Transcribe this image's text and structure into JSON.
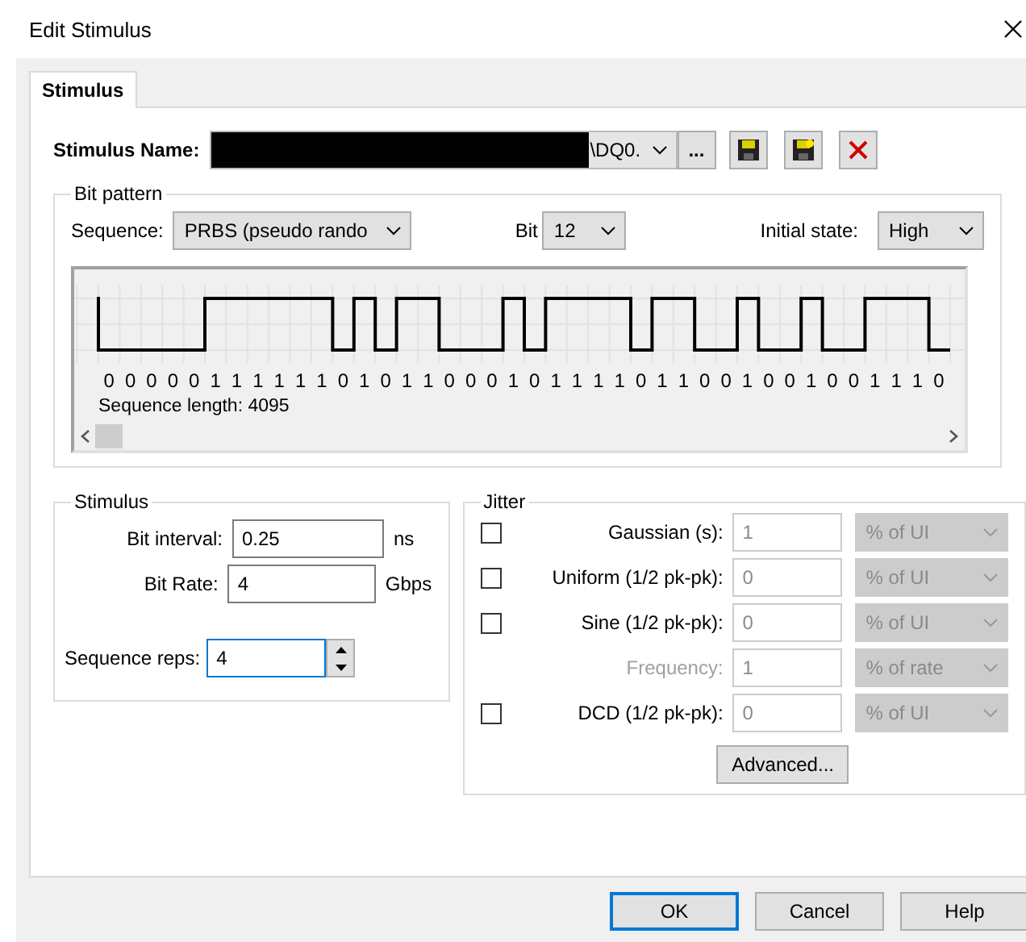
{
  "window": {
    "title": "Edit Stimulus"
  },
  "tabs": [
    {
      "label": "Stimulus",
      "selected": true
    }
  ],
  "stimulus_name": {
    "label": "Stimulus Name:",
    "value": "\\DQ0.",
    "redacted": true,
    "browse": "..."
  },
  "bit_pattern": {
    "title": "Bit pattern",
    "sequence": {
      "label": "Sequence:",
      "value": "PRBS (pseudo rando"
    },
    "bit": {
      "label": "Bit",
      "value": "12"
    },
    "initial_state": {
      "label": "Initial state:",
      "value": "High"
    },
    "bits": [
      "0",
      "0",
      "0",
      "0",
      "0",
      "1",
      "1",
      "1",
      "1",
      "1",
      "1",
      "0",
      "1",
      "0",
      "1",
      "1",
      "0",
      "0",
      "0",
      "1",
      "0",
      "1",
      "1",
      "1",
      "1",
      "0",
      "1",
      "1",
      "0",
      "0",
      "1",
      "0",
      "0",
      "1",
      "0",
      "0",
      "1",
      "1",
      "1",
      "0"
    ],
    "sequence_length": "Sequence length: 4095"
  },
  "stimulus": {
    "title": "Stimulus",
    "fields": [
      {
        "label": "Bit interval:",
        "value": "0.25",
        "unit": "ns"
      },
      {
        "label": "Bit Rate:",
        "value": "4",
        "unit": "Gbps"
      }
    ],
    "reps": {
      "label": "Sequence reps:",
      "value": "4",
      "focused": true
    }
  },
  "jitter": {
    "title": "Jitter",
    "rows": [
      {
        "kind": "check",
        "label": "Gaussian (s):",
        "value": "1",
        "unit": "% of UI",
        "checked": false,
        "disabled": true
      },
      {
        "kind": "check",
        "label": "Uniform (1/2 pk-pk):",
        "value": "0",
        "unit": "% of UI",
        "checked": false,
        "disabled": true
      },
      {
        "kind": "check",
        "label": "Sine (1/2 pk-pk):",
        "value": "0",
        "unit": "% of UI",
        "checked": false,
        "disabled": true
      },
      {
        "kind": "plain",
        "label": "Frequency:",
        "value": "1",
        "unit": "% of rate",
        "disabled": true
      },
      {
        "kind": "check",
        "label": "DCD (1/2 pk-pk):",
        "value": "0",
        "unit": "% of UI",
        "checked": false,
        "disabled": true
      }
    ],
    "advanced": "Advanced..."
  },
  "buttons": [
    {
      "label": "OK",
      "default": true
    },
    {
      "label": "Cancel",
      "default": false
    },
    {
      "label": "Help",
      "default": false
    }
  ]
}
